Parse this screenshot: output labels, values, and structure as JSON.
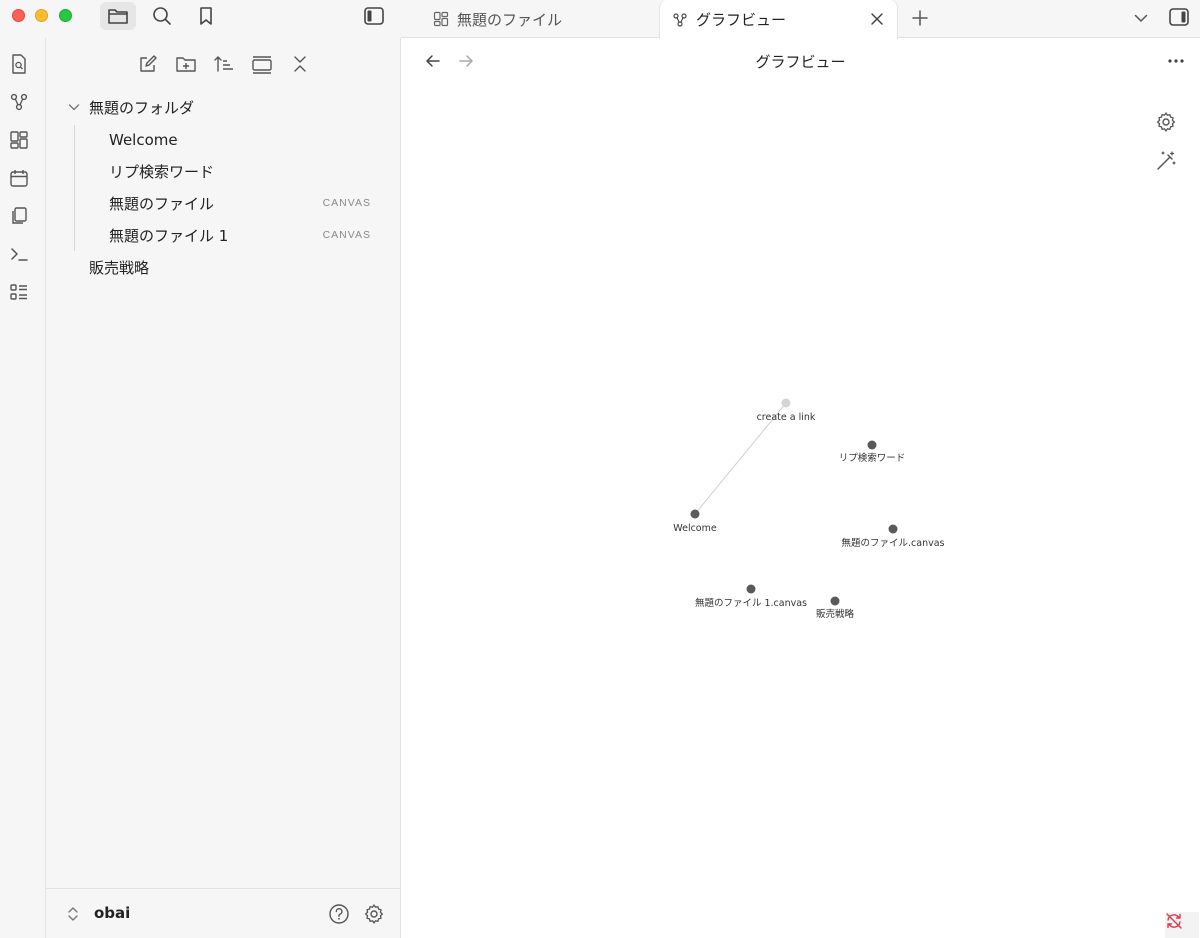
{
  "sidebar": {
    "tree": [
      {
        "label": "無題のフォルダ",
        "type": "folder",
        "expanded": true
      },
      {
        "label": "Welcome"
      },
      {
        "label": "リプ検索ワード"
      },
      {
        "label": "無題のファイル",
        "tag": "CANVAS"
      },
      {
        "label": "無題のファイル 1",
        "tag": "CANVAS"
      },
      {
        "label": "販売戦略"
      }
    ],
    "vault_name": "obai"
  },
  "tabs": [
    {
      "label": "無題のファイル",
      "icon": "canvas-icon"
    },
    {
      "label": "グラフビュー",
      "icon": "graph-icon",
      "active": true
    }
  ],
  "view": {
    "title": "グラフビュー"
  },
  "graph": {
    "nodes": [
      {
        "id": "create",
        "label": "create a link",
        "unresolved": true
      },
      {
        "id": "ripu",
        "label": "リプ検索ワード"
      },
      {
        "id": "welcome",
        "label": "Welcome"
      },
      {
        "id": "mudai",
        "label": "無題のファイル.canvas"
      },
      {
        "id": "mudai1",
        "label": "無題のファイル 1.canvas"
      },
      {
        "id": "hanbai",
        "label": "販売戦略"
      }
    ],
    "links": [
      {
        "source": "welcome",
        "target": "create"
      }
    ],
    "node_color": "#5a5a5a",
    "unresolved_color": "#d4d4d4",
    "link_color": "#d0d0d0"
  }
}
